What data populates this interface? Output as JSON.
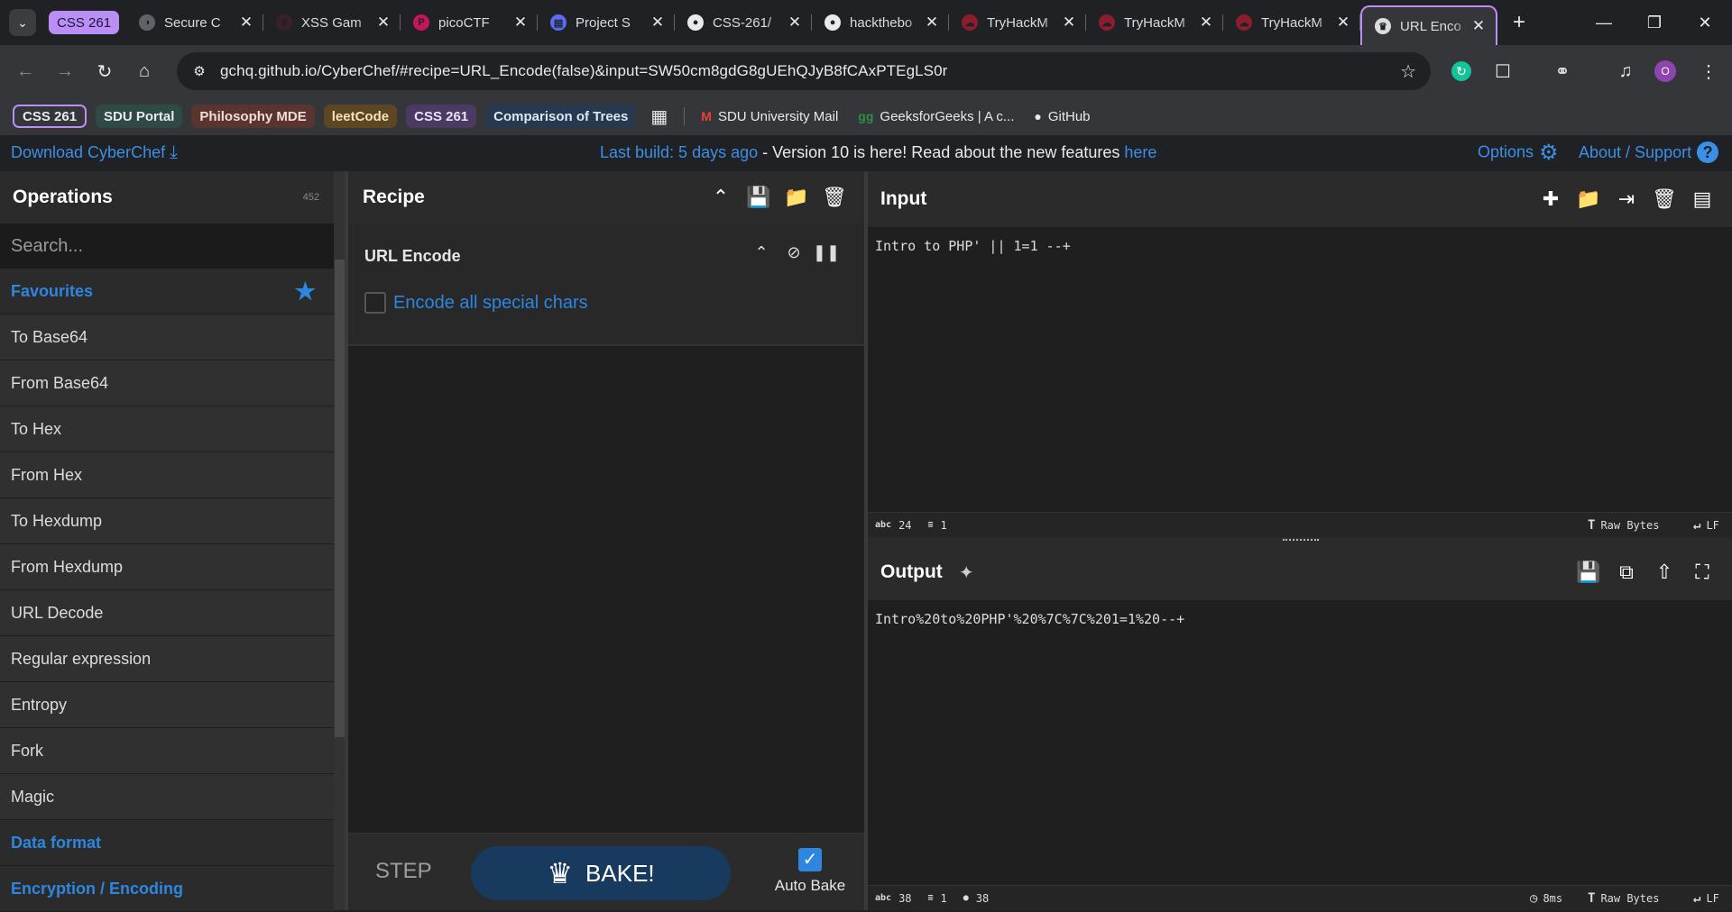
{
  "browser": {
    "group_chip": "CSS 261",
    "tabs": [
      {
        "title": "Secure C",
        "fav": "◑",
        "fav_bg": "#5f6368"
      },
      {
        "title": "XSS Gam",
        "fav": "❦",
        "fav_bg": "#3b1f2b"
      },
      {
        "title": "picoCTF",
        "fav": "P",
        "fav_bg": "#c2185b"
      },
      {
        "title": "Project S",
        "fav": "▤",
        "fav_bg": "#5b6cf0"
      },
      {
        "title": "CSS-261/",
        "fav": "●",
        "fav_bg": "#e8eaed"
      },
      {
        "title": "hackthebo",
        "fav": "●",
        "fav_bg": "#e8eaed"
      },
      {
        "title": "TryHackM",
        "fav": "☁",
        "fav_bg": "#8b1d2c"
      },
      {
        "title": "TryHackM",
        "fav": "☁",
        "fav_bg": "#8b1d2c"
      },
      {
        "title": "TryHackM",
        "fav": "☁",
        "fav_bg": "#8b1d2c"
      }
    ],
    "active_tab": {
      "title": "URL Enco",
      "fav": "♛",
      "fav_bg": "#dadce0"
    },
    "new_tab": "+",
    "url": "gchq.github.io/CyberChef/#recipe=URL_Encode(false)&input=SW50cm8gdG8gUEhQJyB8fCAxPTEgLS0r",
    "profile_initial": "O",
    "bookmarks": {
      "chips": [
        {
          "label": "CSS 261",
          "style": "outline"
        },
        {
          "label": "SDU Portal",
          "bg": "#2f4a44",
          "color": "#e8eaed"
        },
        {
          "label": "Philosophy MDE",
          "bg": "#5a3530",
          "color": "#f2dcd6"
        },
        {
          "label": "leetCode",
          "bg": "#5c4722",
          "color": "#f5e2bd"
        },
        {
          "label": "CSS 261",
          "bg": "#4b3b63",
          "color": "#ece1fa"
        },
        {
          "label": "Comparison of Trees",
          "bg": "#27394f",
          "color": "#dde7f5"
        }
      ],
      "links": [
        {
          "label": "SDU University Mail",
          "icon": "M",
          "icon_color": "#ea4335"
        },
        {
          "label": "GeeksforGeeks | A c...",
          "icon": "ɡɡ",
          "icon_color": "#2f8d46"
        },
        {
          "label": "GitHub",
          "icon": "●",
          "icon_color": "#e8eaed"
        }
      ]
    }
  },
  "cyberchef": {
    "banner": {
      "download": "Download CyberChef",
      "last_build": "Last build: 5 days ago",
      "middle": " - Version 10 is here! Read about the new features ",
      "here": "here",
      "options": "Options",
      "about": "About / Support"
    },
    "operations": {
      "title": "Operations",
      "count": "452",
      "search_placeholder": "Search...",
      "favourites": "Favourites",
      "items": [
        "To Base64",
        "From Base64",
        "To Hex",
        "From Hex",
        "To Hexdump",
        "From Hexdump",
        "URL Decode",
        "Regular expression",
        "Entropy",
        "Fork",
        "Magic"
      ],
      "categories": [
        "Data format",
        "Encryption / Encoding"
      ]
    },
    "recipe": {
      "title": "Recipe",
      "operation": "URL Encode",
      "option_label": "Encode all special chars",
      "step": "STEP",
      "bake": "BAKE!",
      "auto_bake": "Auto Bake"
    },
    "input": {
      "title": "Input",
      "text": "Intro to PHP' || 1=1 --+",
      "chars": "24",
      "lines": "1",
      "encoding": "Raw Bytes",
      "eol": "LF"
    },
    "output": {
      "title": "Output",
      "text": "Intro%20to%20PHP'%20%7C%7C%201=1%20--+",
      "chars": "38",
      "lines": "1",
      "cursor": "38",
      "time": "8ms",
      "encoding": "Raw Bytes",
      "eol": "LF"
    }
  }
}
